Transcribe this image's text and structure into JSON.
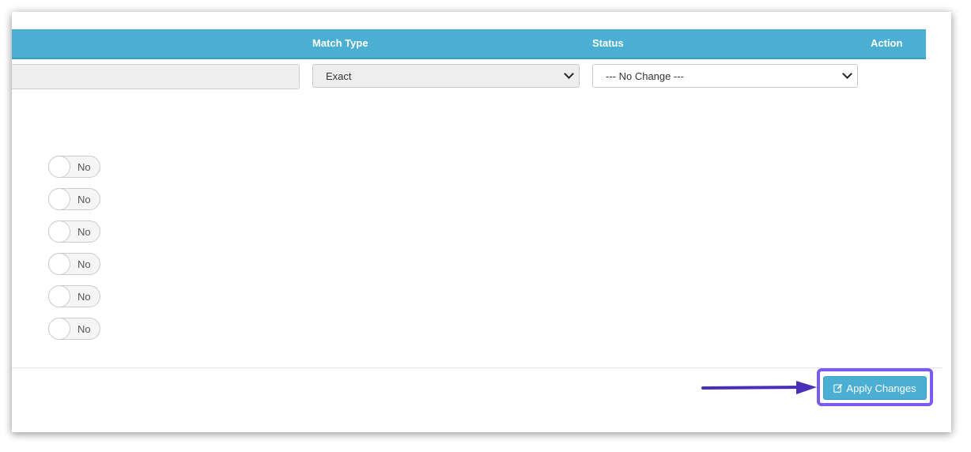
{
  "table_header": {
    "match_type": "Match Type",
    "status": "Status",
    "action": "Action"
  },
  "row": {
    "keyword_value": "",
    "match_type_selected": "Exact",
    "status_selected": "--- No Change ---"
  },
  "toggles": [
    {
      "label": "No"
    },
    {
      "label": "No"
    },
    {
      "label": "No"
    },
    {
      "label": "No"
    },
    {
      "label": "No"
    },
    {
      "label": "No"
    }
  ],
  "footer": {
    "apply_label": "Apply Changes"
  },
  "colors": {
    "header_bg": "#4aafd3",
    "button_bg": "#4aafd3",
    "highlight": "#7b5af0",
    "arrow": "#4a2fb8"
  },
  "icons": {
    "apply": "edit-icon",
    "annotation": "arrow-right-icon"
  }
}
